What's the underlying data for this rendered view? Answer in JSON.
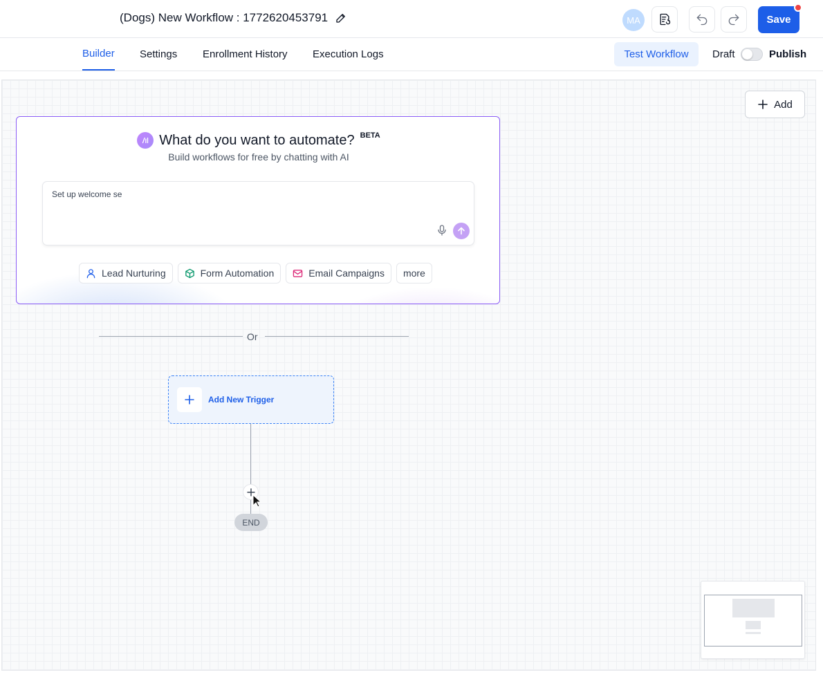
{
  "header": {
    "workflow_title": "(Dogs) New Workflow : 1772620453791",
    "avatar_initials": "MA",
    "save_label": "Save"
  },
  "tabs": [
    {
      "label": "Builder",
      "active": true
    },
    {
      "label": "Settings",
      "active": false
    },
    {
      "label": "Enrollment History",
      "active": false
    },
    {
      "label": "Execution Logs",
      "active": false
    }
  ],
  "toolbar": {
    "test_workflow_label": "Test Workflow",
    "draft_label": "Draft",
    "publish_label": "Publish",
    "publish_enabled": false
  },
  "canvas": {
    "add_label": "Add"
  },
  "ai_card": {
    "title": "What do you want to automate?",
    "badge": "BETA",
    "subtitle": "Build workflows for free by chatting with AI",
    "prompt_value": "Set up welcome se",
    "chips": [
      {
        "label": "Lead Nurturing",
        "icon": "user-icon"
      },
      {
        "label": "Form Automation",
        "icon": "cube-icon"
      },
      {
        "label": "Email Campaigns",
        "icon": "mail-icon"
      },
      {
        "label": "more",
        "icon": ""
      }
    ]
  },
  "divider": {
    "text": "Or"
  },
  "trigger": {
    "label": "Add New Trigger"
  },
  "end_node": {
    "label": "END"
  },
  "colors": {
    "primary": "#1d5ee8",
    "ai_border": "#8b5cf6",
    "notification": "#ef4444"
  }
}
